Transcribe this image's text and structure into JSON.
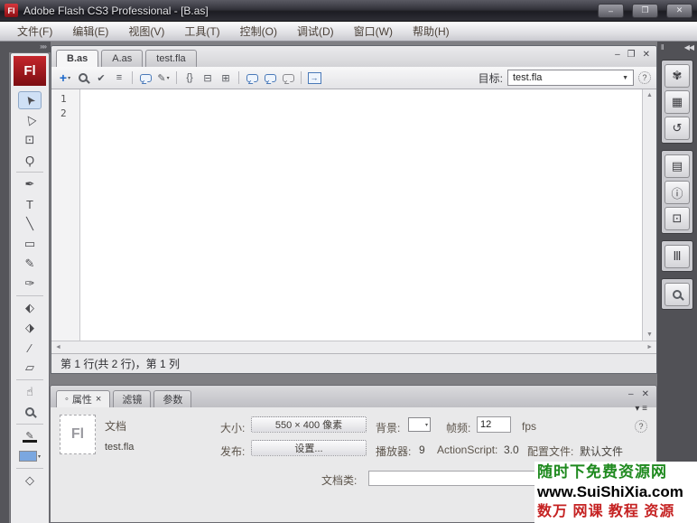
{
  "window": {
    "title": "Adobe Flash CS3 Professional - [B.as]",
    "app_icon_label": "Fl",
    "controls": {
      "minimize": "–",
      "restore": "❐",
      "close": "✕"
    }
  },
  "menu": {
    "items": [
      "文件(F)",
      "编辑(E)",
      "视图(V)",
      "工具(T)",
      "控制(O)",
      "调试(D)",
      "窗口(W)",
      "帮助(H)"
    ]
  },
  "left_dock": {
    "collapse_icon": "»»",
    "logo_label": "Fl"
  },
  "tools": [
    {
      "name": "selection-tool",
      "glyph": "➤",
      "selected": true
    },
    {
      "name": "subselection-tool",
      "glyph": "▷"
    },
    {
      "name": "free-transform-tool",
      "glyph": "⊡"
    },
    {
      "name": "lasso-tool",
      "glyph": "Ϙ"
    },
    {
      "name": "pen-tool",
      "glyph": "✒"
    },
    {
      "name": "text-tool",
      "glyph": "T"
    },
    {
      "name": "line-tool",
      "glyph": "╲"
    },
    {
      "name": "rectangle-tool",
      "glyph": "▭"
    },
    {
      "name": "pencil-tool",
      "glyph": "✎"
    },
    {
      "name": "brush-tool",
      "glyph": "✑"
    },
    {
      "name": "ink-bottle-tool",
      "glyph": "⬖"
    },
    {
      "name": "paint-bucket-tool",
      "glyph": "⬗"
    },
    {
      "name": "eyedropper-tool",
      "glyph": "∕"
    },
    {
      "name": "eraser-tool",
      "glyph": "▱"
    },
    {
      "name": "hand-tool",
      "glyph": "☝"
    },
    {
      "name": "zoom-tool",
      "glyph": ""
    },
    {
      "name": "stroke-color-control",
      "glyph": "✎"
    },
    {
      "name": "fill-color-control",
      "glyph": ""
    },
    {
      "name": "color-options-control",
      "glyph": "◇"
    }
  ],
  "document_window": {
    "tabs": [
      {
        "label": "B.as",
        "active": true
      },
      {
        "label": "A.as",
        "active": false
      },
      {
        "label": "test.fla",
        "active": false
      }
    ],
    "controls": {
      "minimize": "–",
      "restore": "❐",
      "close": "✕"
    },
    "toolbar": {
      "icons": [
        {
          "name": "add-script-icon",
          "glyph": "+"
        },
        {
          "name": "find-replace-icon",
          "glyph": ""
        },
        {
          "name": "check-syntax-icon",
          "glyph": "✔"
        },
        {
          "name": "auto-format-icon",
          "glyph": "≡"
        },
        {
          "name": "show-code-hint-icon",
          "glyph": ""
        },
        {
          "name": "debug-options-icon",
          "glyph": "✎"
        },
        {
          "name": "collapse-braces-icon",
          "glyph": "{}"
        },
        {
          "name": "collapse-selection-icon",
          "glyph": "⊟"
        },
        {
          "name": "expand-all-icon",
          "glyph": "⊞"
        },
        {
          "name": "block-comment-icon",
          "glyph": ""
        },
        {
          "name": "line-comment-icon",
          "glyph": ""
        },
        {
          "name": "remove-comment-icon",
          "glyph": ""
        },
        {
          "name": "toolbox-toggle-icon",
          "glyph": "→"
        }
      ],
      "dropdown_arrow": "▾",
      "target_label": "目标:",
      "target_value": "test.fla",
      "help_glyph": "?"
    },
    "editor": {
      "line_numbers": [
        "1",
        "2"
      ],
      "content": ""
    },
    "scrollbar": {
      "up": "▲",
      "down": "▼",
      "left": "◄",
      "right": "►"
    },
    "status_text": "第 1 行(共 2 行)，第 1 列"
  },
  "properties_panel": {
    "tabs": [
      {
        "label": "属性",
        "active": true,
        "dot": "◦",
        "close": "×"
      },
      {
        "label": "滤镜",
        "active": false
      },
      {
        "label": "参数",
        "active": false
      }
    ],
    "controls": {
      "minimize": "–",
      "close": "✕",
      "menu": "▾ ≡",
      "help": "?"
    },
    "doc": {
      "icon_label": "Fl",
      "type_label": "文档",
      "name": "test.fla"
    },
    "fields": {
      "size_label": "大小:",
      "size_value": "550 × 400 像素",
      "publish_label": "发布:",
      "publish_value": "设置...",
      "background_label": "背景:",
      "framerate_label": "帧频:",
      "framerate_value": "12",
      "fps_label": "fps",
      "player_label": "播放器:",
      "player_value": "9",
      "actionscript_label": "ActionScript:",
      "actionscript_value": "3.0",
      "profile_label": "配置文件:",
      "profile_value": "默认文件",
      "docclass_label": "文档类:",
      "docclass_value": ""
    }
  },
  "right_dock": {
    "handle_icon": "‖",
    "collapse_icon": "◀◀",
    "groups": [
      {
        "items": [
          {
            "name": "color-panel-icon",
            "glyph": "✾"
          },
          {
            "name": "swatches-panel-icon",
            "glyph": "▦"
          },
          {
            "name": "history-panel-icon",
            "glyph": "↺"
          }
        ]
      },
      {
        "items": [
          {
            "name": "align-panel-icon",
            "glyph": "▤"
          },
          {
            "name": "info-panel-icon",
            "glyph": "ⓘ"
          },
          {
            "name": "transform-panel-icon",
            "glyph": "⊡"
          }
        ]
      },
      {
        "items": [
          {
            "name": "library-panel-icon",
            "glyph": "Ⅲ"
          }
        ]
      },
      {
        "items": [
          {
            "name": "movie-explorer-panel-icon",
            "glyph": ""
          }
        ]
      }
    ]
  },
  "watermark": {
    "line1": "随时下免费资源网",
    "line2": "www.SuiShiXia.com",
    "line3": "数万 网课 教程 资源"
  },
  "colors": {
    "app_icon_red": "#b5121b",
    "titlebar": "#2b2b31",
    "workspace_gray": "#7f7f83",
    "selected_tool_bg": "#cfe0f5",
    "fill_swatch_blue": "#7ba7e0",
    "watermark_green": "#1f8a1f",
    "watermark_red": "#c52222"
  }
}
